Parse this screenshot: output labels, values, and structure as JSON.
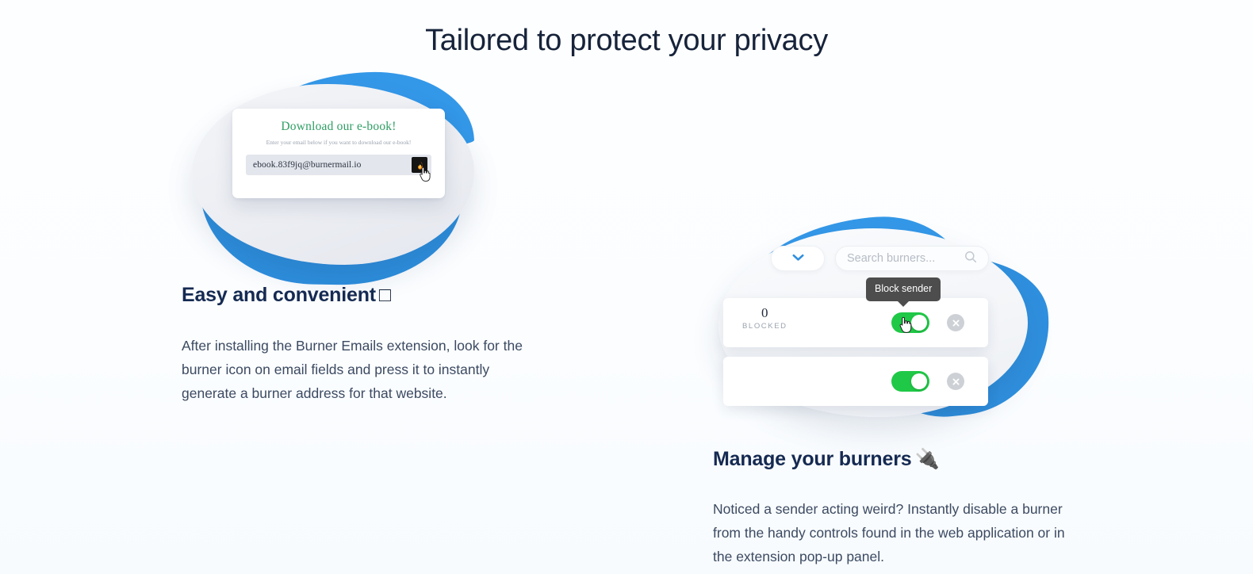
{
  "section": {
    "title": "Tailored to protect your privacy",
    "background_color": "#fbfdff",
    "title_color": "#16233a",
    "accent_blue": "#3498e8",
    "accent_blue_dark": "#2d8fde",
    "toggle_green": "#1fc947",
    "heading_navy": "#152a52"
  },
  "features": [
    {
      "id": "easy-and-convenient",
      "title": "Easy and convenient",
      "title_emoji": "□",
      "body": "After installing the Burner Emails extension, look for the burner icon on email fields and press it to instantly generate a burner address for that website."
    },
    {
      "id": "manage-your-burners",
      "title": "Manage your burners",
      "title_emoji": "🔌",
      "body": "Noticed a sender acting weird? Instantly disable a burner from the handy controls found in the web application or in the extension pop-up panel."
    }
  ],
  "illustration_ebook": {
    "form_heading": "Download our e-book!",
    "form_subtitle": "Enter your email below if you want to download our e-book!",
    "email_value": "ebook.83f9jq@burnermail.io",
    "burner_icon": "fire-icon",
    "burner_icon_glyph": "🔥",
    "cursor": "pointer-hand-cursor"
  },
  "illustration_burners": {
    "dropdown_icon": "chevron-down-icon",
    "search_placeholder": "Search burners...",
    "search_icon": "search-icon",
    "tooltip": "Block sender",
    "rows": [
      {
        "count": "0",
        "label": "BLOCKED",
        "toggle_state": "on",
        "delete_icon": "close-circle-icon"
      },
      {
        "count": "",
        "label": "",
        "toggle_state": "on",
        "delete_icon": "close-circle-icon"
      }
    ],
    "cursor": "pointer-hand-cursor"
  }
}
